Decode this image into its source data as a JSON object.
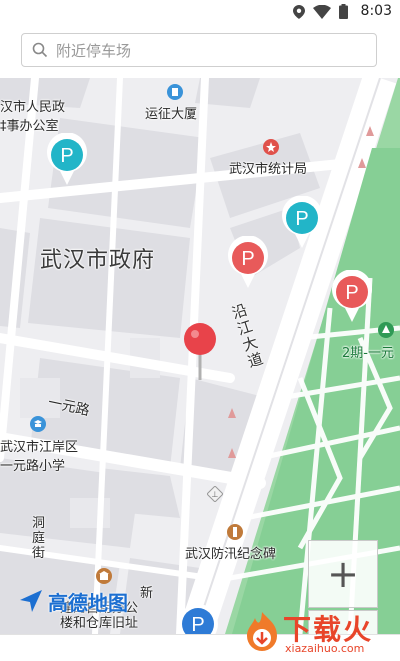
{
  "status_bar": {
    "time": "8:03"
  },
  "search": {
    "placeholder": "附近停车场"
  },
  "map": {
    "labels": {
      "gov_office_line1": "汉市人民政",
      "gov_office_line2": "‡事办公室",
      "yunzheng": "运征大厦",
      "stats_bureau": "武汉市统计局",
      "city_gov": "武汉市政府",
      "yanjiang": "沿江大道",
      "park_2": "2期-一元",
      "yiyuan_road": "一元路",
      "school_line1": "武汉市江岸区",
      "school_line2": "一元路小学",
      "flood_monument": "武汉防汛纪念碑",
      "dongting": "洞庭街",
      "building_line1": "新",
      "building_line2": "建的自用办公",
      "building_line3": "楼和仓库旧址"
    },
    "parking_pin_label": "P",
    "zoom_in": "+",
    "zoom_out": "−",
    "logo_text": "高德地图"
  },
  "watermark": {
    "brand": "下载火",
    "url": "xiazaihuo.com"
  }
}
